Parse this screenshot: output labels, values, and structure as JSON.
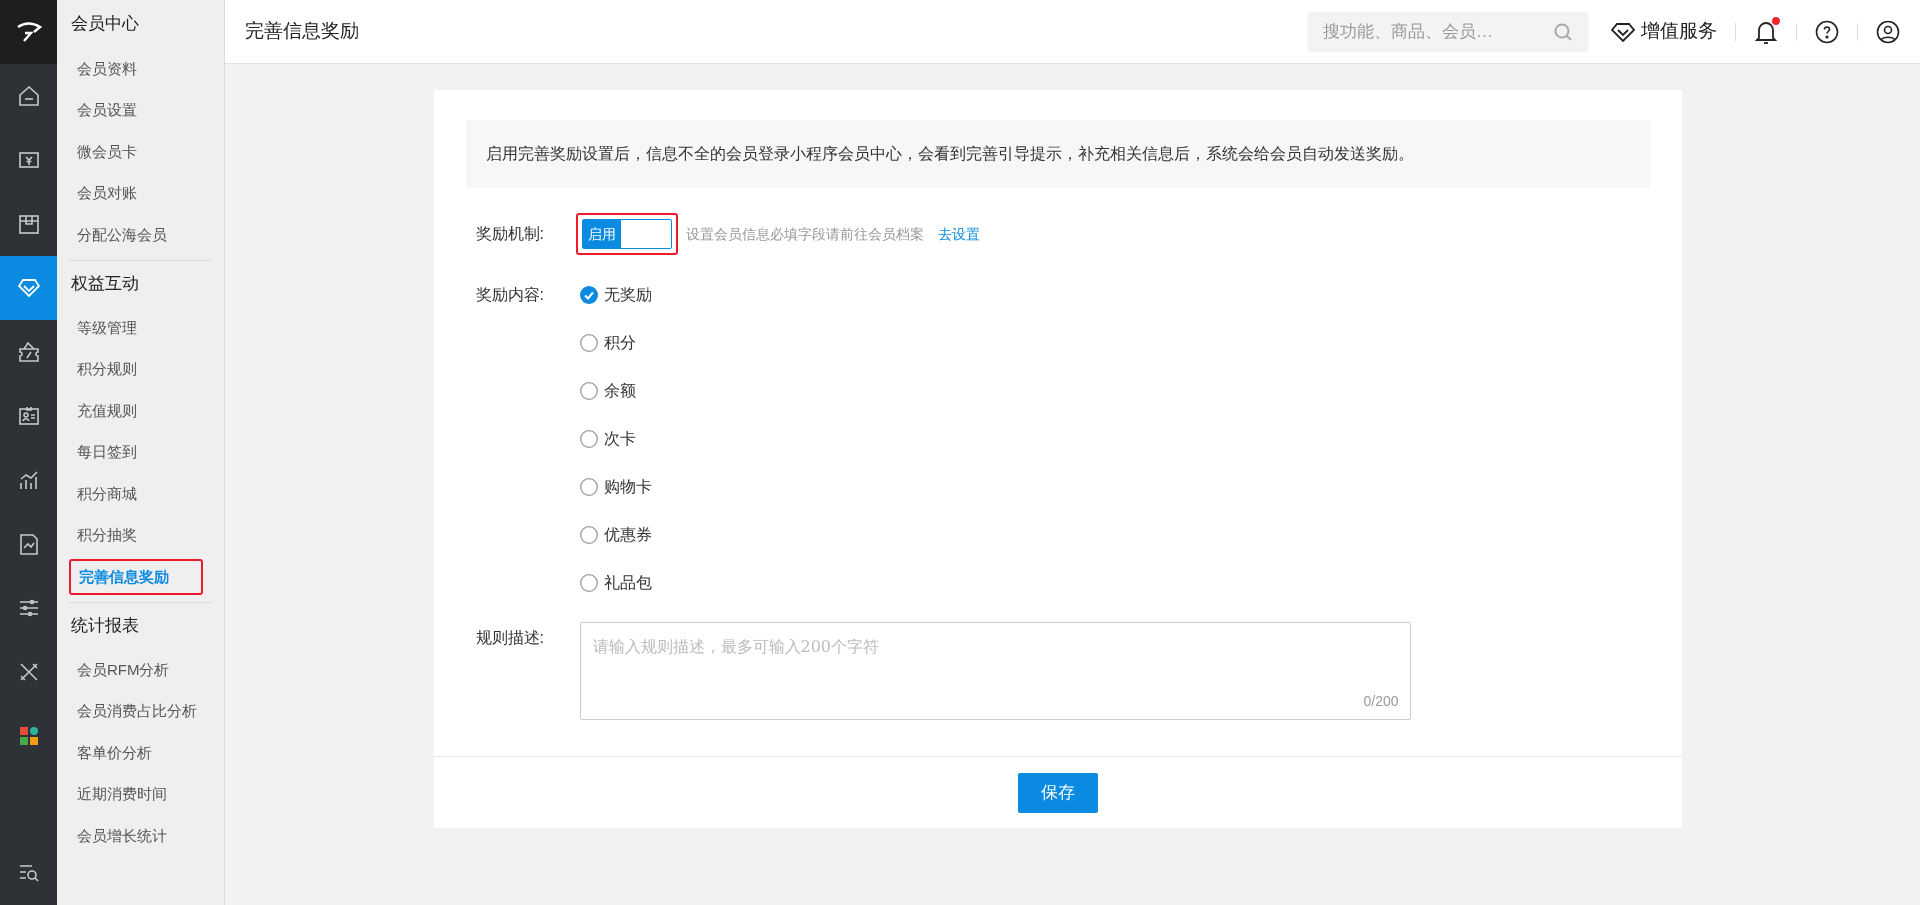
{
  "rail": [
    {
      "kind": "home",
      "selected": false
    },
    {
      "kind": "money",
      "selected": false
    },
    {
      "kind": "box",
      "selected": false
    },
    {
      "kind": "diamond",
      "selected": true
    },
    {
      "kind": "ticket",
      "selected": false
    },
    {
      "kind": "card",
      "selected": false
    },
    {
      "kind": "chart",
      "selected": false
    },
    {
      "kind": "report",
      "selected": false
    },
    {
      "kind": "sliders",
      "selected": false
    },
    {
      "kind": "tools",
      "selected": false
    },
    {
      "kind": "apps",
      "selected": false
    },
    {
      "kind": "list-search",
      "selected": false
    }
  ],
  "sidebar": {
    "groups": [
      {
        "title": "会员中心",
        "items": [
          {
            "label": "会员资料",
            "selected": false,
            "highlighted": false
          },
          {
            "label": "会员设置",
            "selected": false,
            "highlighted": false
          },
          {
            "label": "微会员卡",
            "selected": false,
            "highlighted": false
          },
          {
            "label": "会员对账",
            "selected": false,
            "highlighted": false
          },
          {
            "label": "分配公海会员",
            "selected": false,
            "highlighted": false
          }
        ]
      },
      {
        "title": "权益互动",
        "items": [
          {
            "label": "等级管理",
            "selected": false,
            "highlighted": false
          },
          {
            "label": "积分规则",
            "selected": false,
            "highlighted": false
          },
          {
            "label": "充值规则",
            "selected": false,
            "highlighted": false
          },
          {
            "label": "每日签到",
            "selected": false,
            "highlighted": false
          },
          {
            "label": "积分商城",
            "selected": false,
            "highlighted": false
          },
          {
            "label": "积分抽奖",
            "selected": false,
            "highlighted": false
          },
          {
            "label": "完善信息奖励",
            "selected": true,
            "highlighted": true
          }
        ]
      },
      {
        "title": "统计报表",
        "items": [
          {
            "label": "会员RFM分析",
            "selected": false,
            "highlighted": false
          },
          {
            "label": "会员消费占比分析",
            "selected": false,
            "highlighted": false
          },
          {
            "label": "客单价分析",
            "selected": false,
            "highlighted": false
          },
          {
            "label": "近期消费时间",
            "selected": false,
            "highlighted": false
          },
          {
            "label": "会员增长统计",
            "selected": false,
            "highlighted": false
          }
        ]
      }
    ]
  },
  "top_bar": {
    "title": "完善信息奖励",
    "search": {
      "placeholder": "搜功能、商品、会员…"
    },
    "value_service": "增值服务",
    "unread_dot": true
  },
  "notice": "启用完善奖励设置后，信息不全的会员登录小程序会员中心，会看到完善引导提示，补充相关信息后，系统会给会员自动发送奖励。",
  "mechanism": {
    "label": "奖励机制:",
    "switch": {
      "text": "启用",
      "on": true,
      "highlighted": true
    },
    "hint": "设置会员信息必填字段请前往会员档案",
    "link": "去设置"
  },
  "reward": {
    "label": "奖励内容:",
    "options": [
      {
        "label": "无奖励",
        "selected": true
      },
      {
        "label": "积分",
        "selected": false
      },
      {
        "label": "余额",
        "selected": false
      },
      {
        "label": "次卡",
        "selected": false
      },
      {
        "label": "购物卡",
        "selected": false
      },
      {
        "label": "优惠券",
        "selected": false
      },
      {
        "label": "礼品包",
        "selected": false
      }
    ]
  },
  "description": {
    "label": "规则描述:",
    "placeholder": "请输入规则描述，最多可输入200个字符",
    "counter": "0/200"
  },
  "save": "保存"
}
